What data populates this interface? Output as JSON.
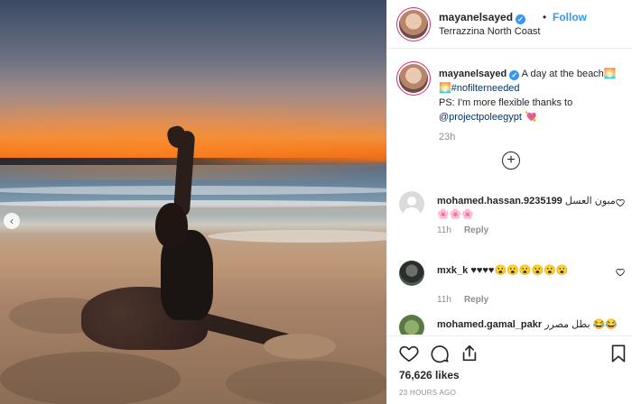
{
  "post": {
    "username": "mayanelsayed",
    "follow_label": "Follow",
    "dot": "•",
    "location": "Terrazzina North Coast"
  },
  "caption": {
    "username": "mayanelsayed",
    "line1": "A day at the beach🌅",
    "line2_prefix": "🌅",
    "hashtag": "#nofilterneeded",
    "line3": "PS: I'm more flexible thanks to",
    "mention": "@projectpoleegypt",
    "mention_emoji": "💘",
    "time": "23h"
  },
  "comments": [
    {
      "username": "mohamed.hassan.9235199",
      "text": "مبون العسل 🌸🌸🌸",
      "time": "11h",
      "reply_label": "Reply"
    },
    {
      "username": "mxk_k",
      "text": "♥♥♥♥😮😮😮😮😮😮",
      "time": "11h",
      "reply_label": "Reply"
    },
    {
      "username": "mohamed.gamal_pakr",
      "text": "بطل مصرر 😂😂",
      "time": "",
      "reply_label": ""
    }
  ],
  "stats": {
    "likes": "76,626 likes",
    "posted": "23 HOURS AGO"
  },
  "icons": {
    "verified": "verified-badge-icon",
    "load_more": "plus-circle-icon",
    "carousel": "chevron-left-icon",
    "like": "heart-icon",
    "comment": "comment-bubble-icon",
    "share": "share-icon",
    "save": "bookmark-icon"
  },
  "colors": {
    "accent": "#3897f0",
    "text": "#262626",
    "muted": "#8e8e8e",
    "link": "#003569"
  }
}
